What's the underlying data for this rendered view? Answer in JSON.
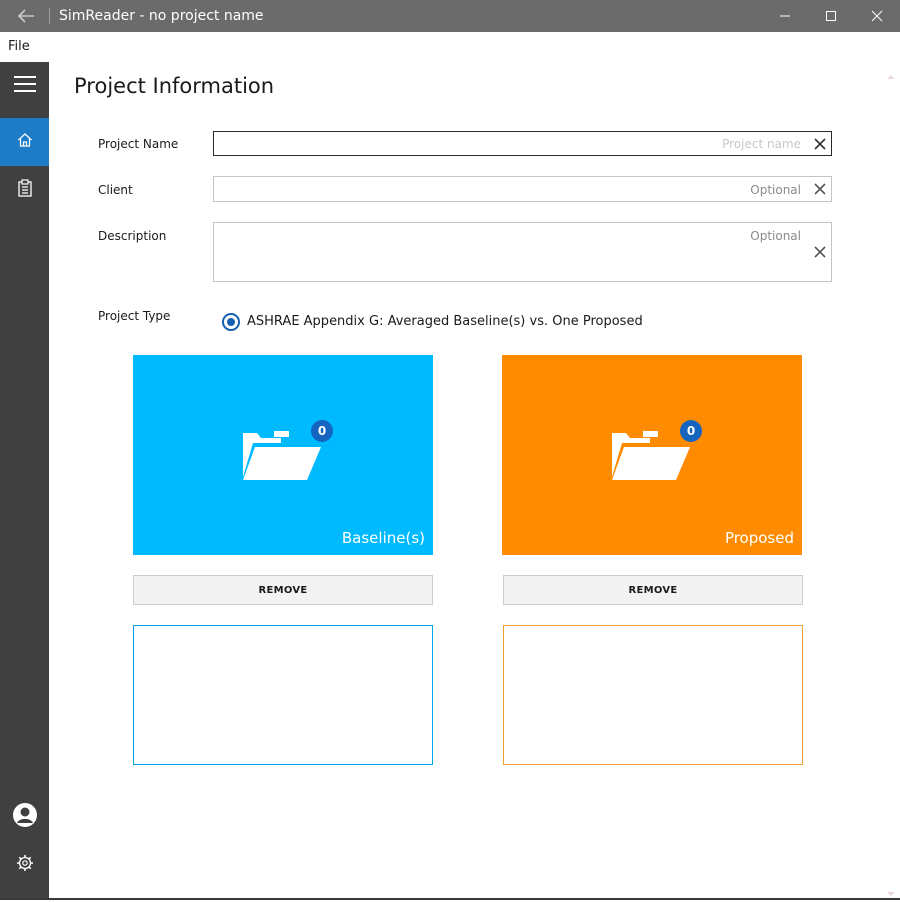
{
  "window": {
    "title": "SimReader - no project name"
  },
  "menu": {
    "file_label": "File"
  },
  "nav": {
    "items": [
      {
        "icon": "hamburger-icon"
      },
      {
        "icon": "home-icon",
        "active": true
      },
      {
        "icon": "clipboard-icon"
      },
      {
        "icon": "user-icon"
      },
      {
        "icon": "gear-icon"
      }
    ],
    "accent": "#1e7cc6"
  },
  "page": {
    "title": "Project Information"
  },
  "form": {
    "project_name": {
      "label": "Project Name",
      "value": "",
      "placeholder": "Project name"
    },
    "client": {
      "label": "Client",
      "value": "",
      "placeholder": "Optional"
    },
    "description": {
      "label": "Description",
      "value": "",
      "placeholder": "Optional"
    },
    "project_type": {
      "label": "Project Type",
      "option": "ASHRAE Appendix G: Averaged Baseline(s) vs. One Proposed",
      "selected": true
    }
  },
  "tiles": {
    "baseline": {
      "label": "Baseline(s)",
      "count": "0",
      "color": "#00baff",
      "remove_label": "REMOVE"
    },
    "proposed": {
      "label": "Proposed",
      "count": "0",
      "color": "#ff8c00",
      "remove_label": "REMOVE"
    }
  }
}
